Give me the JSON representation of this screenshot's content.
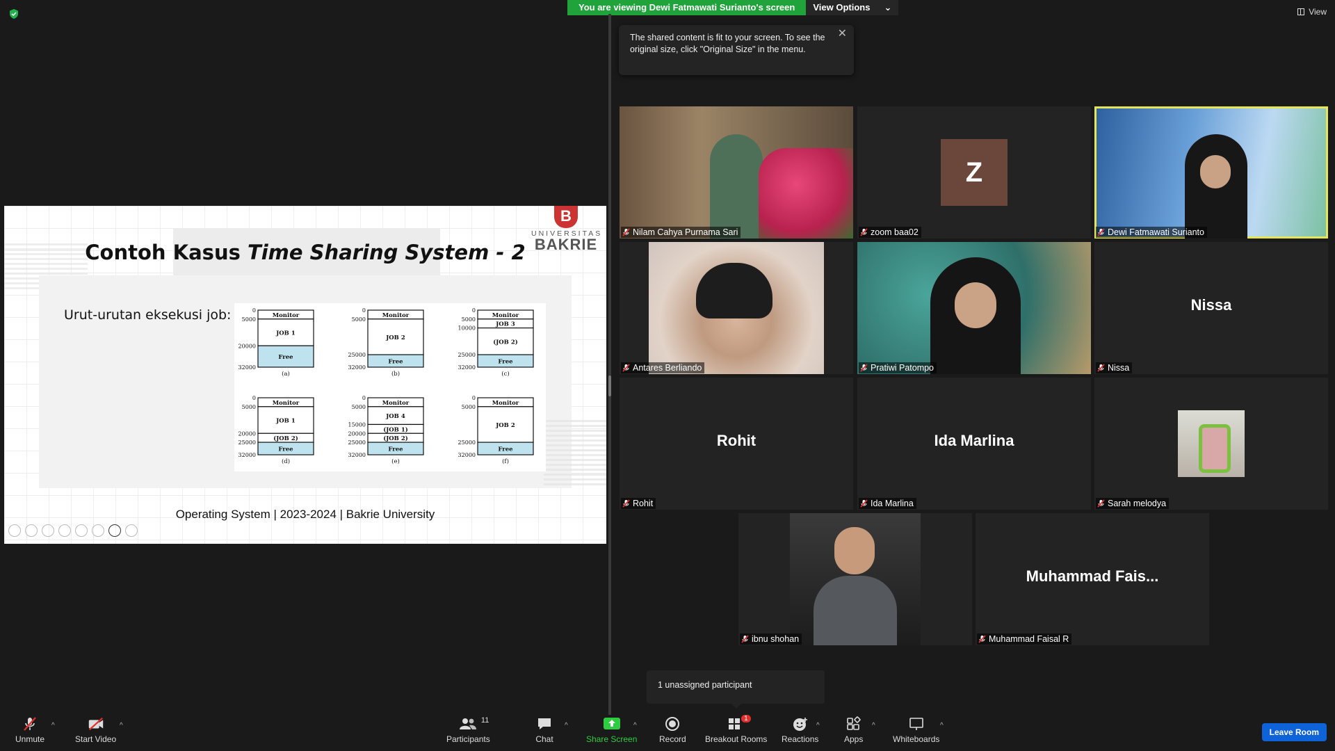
{
  "banner": {
    "viewing": "You are viewing Dewi Fatmawati Surianto's screen",
    "view_options": "View Options"
  },
  "view_button": "View",
  "tooltip": {
    "text": "The shared content is fit to your screen. To see the original size, click \"Original Size\" in the menu."
  },
  "slide": {
    "title_normal": "Contoh Kasus ",
    "title_italic": "Time Sharing System - 2",
    "logo_line1": "UNIVERSITAS",
    "logo_line2": "BAKRIE",
    "logo_letter": "B",
    "label": "Urut-urutan eksekusi job:",
    "footer": "Operating System | 2023-2024 | Bakrie University",
    "diagrams": [
      {
        "caption": "(a)",
        "addresses": [
          "0",
          "5000",
          "20000",
          "32000"
        ],
        "blocks": [
          "Monitor",
          "JOB 1",
          "Free"
        ]
      },
      {
        "caption": "(b)",
        "addresses": [
          "0",
          "5000",
          "25000",
          "32000"
        ],
        "blocks": [
          "Monitor",
          "JOB 2",
          "Free"
        ]
      },
      {
        "caption": "(c)",
        "addresses": [
          "0",
          "5000",
          "10000",
          "25000",
          "32000"
        ],
        "blocks": [
          "Monitor",
          "JOB 3",
          "(JOB 2)",
          "Free"
        ]
      },
      {
        "caption": "(d)",
        "addresses": [
          "0",
          "5000",
          "20000",
          "25000",
          "32000"
        ],
        "blocks": [
          "Monitor",
          "JOB 1",
          "(JOB 2)",
          "Free"
        ]
      },
      {
        "caption": "(e)",
        "addresses": [
          "0",
          "5000",
          "15000",
          "20000",
          "25000",
          "32000"
        ],
        "blocks": [
          "Monitor",
          "JOB 4",
          "(JOB 1)",
          "(JOB 2)",
          "Free"
        ]
      },
      {
        "caption": "(f)",
        "addresses": [
          "0",
          "5000",
          "25000",
          "32000"
        ],
        "blocks": [
          "Monitor",
          "JOB 2",
          "Free"
        ]
      }
    ]
  },
  "participants": [
    {
      "name": "Nilam Cahya Purnama Sari"
    },
    {
      "name": "zoom baa02",
      "avatar_letter": "Z"
    },
    {
      "name": "Dewi Fatmawati Surianto"
    },
    {
      "name": "Antares Berliando"
    },
    {
      "name": "Pratiwi Patompo"
    },
    {
      "name": "Nissa",
      "big_name": "Nissa"
    },
    {
      "name": "Rohit",
      "big_name": "Rohit"
    },
    {
      "name": "Ida Marlina",
      "big_name": "Ida Marlina"
    },
    {
      "name": "Sarah melodya"
    },
    {
      "name": "ibnu shohan"
    },
    {
      "name": "Muhammad Faisal R",
      "big_name": "Muhammad  Fais..."
    }
  ],
  "unassigned": "1 unassigned participant",
  "toolbar": {
    "unmute": "Unmute",
    "start_video": "Start Video",
    "participants": "Participants",
    "participants_count": "11",
    "chat": "Chat",
    "share_screen": "Share Screen",
    "record": "Record",
    "breakout_rooms": "Breakout Rooms",
    "breakout_badge": "1",
    "reactions": "Reactions",
    "apps": "Apps",
    "whiteboards": "Whiteboards",
    "leave": "Leave Room"
  },
  "colors": {
    "accent_green": "#1fa33a",
    "active_speaker": "#e5e55a",
    "leave_blue": "#0e63d8",
    "free_block": "#bfe3ee"
  }
}
